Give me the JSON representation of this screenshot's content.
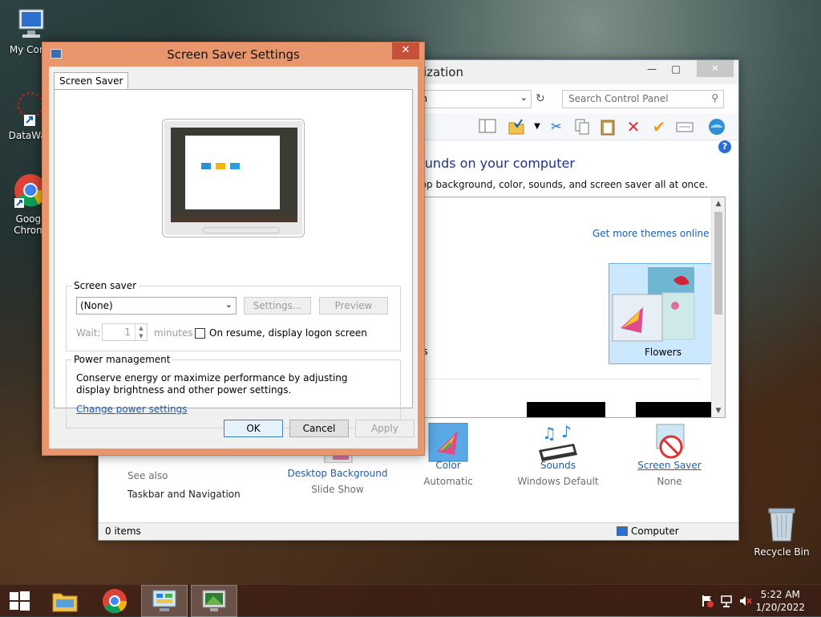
{
  "desktop": {
    "icons": [
      {
        "label": "My Comp"
      },
      {
        "label": "DataWag"
      },
      {
        "label": "Googl Chrom"
      },
      {
        "label": "Recycle Bin"
      }
    ]
  },
  "control_panel": {
    "title_fragment": "ization",
    "address_fragment": "tion",
    "search_placeholder": "Search Control Panel",
    "heading_fragment": "ounds on your computer",
    "sub_fragment": "top background, color, sounds, and screen saver all at once.",
    "get_more_themes": "Get more themes online",
    "themes": [
      {
        "label": "Lines and colors",
        "selected": false
      },
      {
        "label": "Flowers",
        "selected": true
      }
    ],
    "see_also": {
      "title": "See also",
      "item": "Taskbar and Navigation"
    },
    "bottom_items": [
      {
        "label": "Desktop Background",
        "value": "Slide Show"
      },
      {
        "label": "Color",
        "value": "Automatic"
      },
      {
        "label": "Sounds",
        "value": "Windows Default"
      },
      {
        "label": "Screen Saver",
        "value": "None"
      }
    ],
    "status": {
      "items": "0 items",
      "location": "Computer"
    }
  },
  "dialog": {
    "title": "Screen Saver Settings",
    "tab": "Screen Saver",
    "screen_saver": {
      "group_label": "Screen saver",
      "selected": "(None)",
      "settings_button": "Settings...",
      "preview_button": "Preview",
      "wait_label": "Wait:",
      "wait_value": "1",
      "minutes_label": "minutes",
      "resume_label": "On resume, display logon screen",
      "resume_checked": false
    },
    "power": {
      "group_label": "Power management",
      "description": "Conserve energy or maximize performance by adjusting display brightness and other power settings.",
      "link": "Change power settings"
    },
    "buttons": {
      "ok": "OK",
      "cancel": "Cancel",
      "apply": "Apply"
    }
  },
  "taskbar": {
    "time": "5:22 AM",
    "date": "1/20/2022"
  }
}
